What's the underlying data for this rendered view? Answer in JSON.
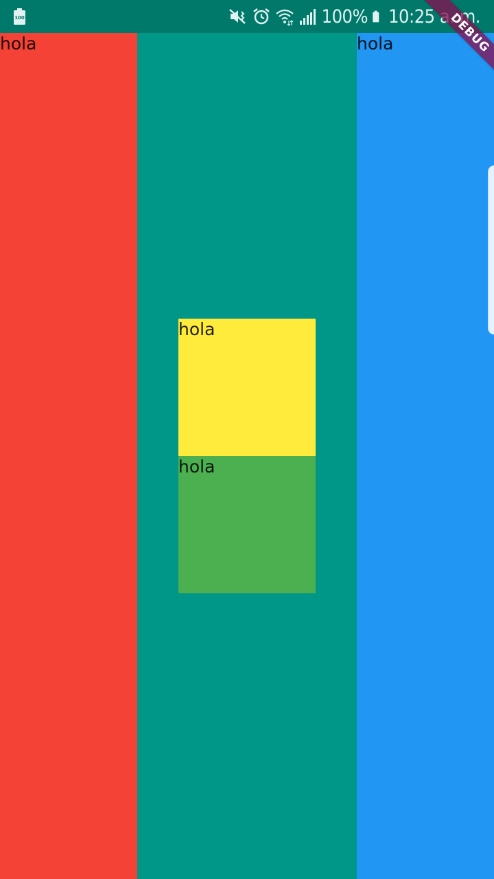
{
  "status_bar": {
    "battery_level": "100%",
    "time": "10:25 a. m.",
    "left_icon": "battery-saver-icon",
    "icons": [
      "mute-vibrate-icon",
      "alarm-icon",
      "wifi-icon",
      "signal-icon",
      "battery-icon"
    ]
  },
  "columns": {
    "left": {
      "label": "hola",
      "color": "#F44336"
    },
    "center": {
      "color": "#009688"
    },
    "right": {
      "label": "hola",
      "color": "#2196F3"
    }
  },
  "boxes": {
    "yellow": {
      "label": "hola",
      "color": "#FFEB3B"
    },
    "green": {
      "label": "hola",
      "color": "#4CAF50"
    }
  },
  "debug_banner": {
    "label": "DEBUG"
  }
}
